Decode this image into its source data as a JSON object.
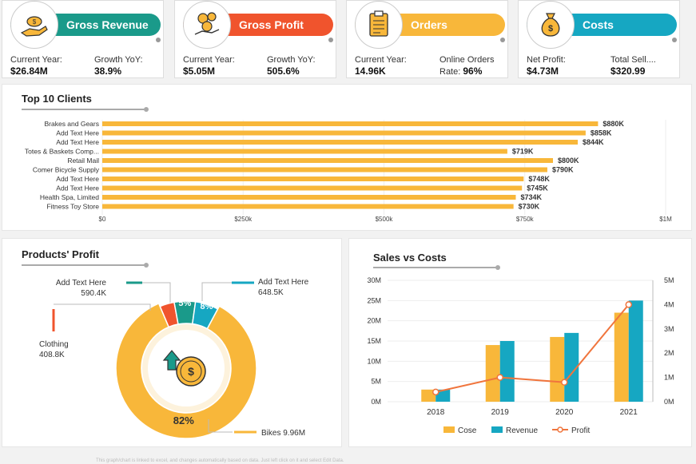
{
  "kpis": [
    {
      "title": "Gross Revenue",
      "color": "#1a9a8a",
      "icon": "money-hand-icon",
      "left_label": "Current Year:",
      "left_value": "$26.84M",
      "right_label": "Growth YoY:",
      "right_value": "38.9%"
    },
    {
      "title": "Gross Profit",
      "color": "#f0542d",
      "icon": "coins-hand-icon",
      "left_label": "Current Year:",
      "left_value": "$5.05M",
      "right_label": "Growth YoY:",
      "right_value": "505.6%"
    },
    {
      "title": "Orders",
      "color": "#f8b73a",
      "icon": "clipboard-icon",
      "left_label": "Current Year:",
      "left_value": "14.96K",
      "right_label": "Online Orders",
      "right_value_prefix": "Rate: ",
      "right_value": "96%"
    },
    {
      "title": "Costs",
      "color": "#16a7c2",
      "icon": "money-bag-icon",
      "left_label": "Net Profit:",
      "left_value": "$4.73M",
      "right_label": "Total Sell....",
      "right_value": "$320.99"
    }
  ],
  "top_clients": {
    "title": "Top 10 Clients",
    "chart_data": {
      "type": "bar",
      "orientation": "horizontal",
      "categories": [
        "Brakes and Gears",
        "Add Text Here",
        "Add Text Here",
        "Totes & Baskets Comp...",
        "Retail Mail",
        "Comer Bicycle Supply",
        "Add Text Here",
        "Add Text Here",
        "Health Spa, Limited",
        "Fitness Toy Store"
      ],
      "values": [
        880,
        858,
        844,
        719,
        800,
        790,
        748,
        745,
        734,
        730
      ],
      "value_labels": [
        "$880K",
        "$858K",
        "$844K",
        "$719K",
        "$800K",
        "$790K",
        "$748K",
        "$745K",
        "$734K",
        "$730K"
      ],
      "x_ticks": [
        "$0",
        "$250k",
        "$500k",
        "$750k",
        "$1M"
      ],
      "xlim": [
        0,
        1000
      ],
      "unit": "K",
      "color": "#f8b73a"
    }
  },
  "products_profit": {
    "title": "Products' Profit",
    "chart_data": {
      "type": "pie",
      "style": "donut",
      "slices": [
        {
          "name": "Bikes",
          "value": 9.96,
          "value_label": "9.96M",
          "pct_label": "82%",
          "color": "#f8b73a"
        },
        {
          "name": "Clothing",
          "value": 0.4088,
          "value_label": "408.8K",
          "pct_label": "",
          "color": "#f0542d"
        },
        {
          "name": "Add Text Here",
          "value": 0.5904,
          "value_label": "590.4K",
          "pct_label": "5%",
          "color": "#1a9a8a"
        },
        {
          "name": "Add Text Here",
          "value": 0.6485,
          "value_label": "648.5K",
          "pct_label": "8%",
          "color": "#16a7c2"
        }
      ],
      "inner_labels": [
        "5%",
        "5%",
        "8%"
      ]
    }
  },
  "sales_costs": {
    "title": "Sales vs Costs",
    "chart_data": {
      "type": "bar",
      "categories": [
        "2018",
        "2019",
        "2020",
        "2021"
      ],
      "series": [
        {
          "name": "Cose",
          "kind": "bar",
          "axis": "left",
          "color": "#f8b73a",
          "values": [
            3,
            14,
            16,
            22
          ]
        },
        {
          "name": "Revenue",
          "kind": "bar",
          "axis": "left",
          "color": "#16a7c2",
          "values": [
            3,
            15,
            17,
            25
          ]
        },
        {
          "name": "Profit",
          "kind": "line",
          "axis": "right",
          "color": "#f0753d",
          "values": [
            0.4,
            1.0,
            0.8,
            4.0
          ]
        }
      ],
      "ylim": [
        0,
        30
      ],
      "y_ticks": [
        "0M",
        "5M",
        "10M",
        "15M",
        "20M",
        "25M",
        "30M"
      ],
      "y2lim": [
        0,
        5
      ],
      "y2_ticks": [
        "0M",
        "1M",
        "2M",
        "3M",
        "4M",
        "5M"
      ],
      "legend": "bottom"
    }
  },
  "footer_text": "This graph/chart is linked to excel, and changes automatically based on data. Just left click on it and select Edit Data."
}
